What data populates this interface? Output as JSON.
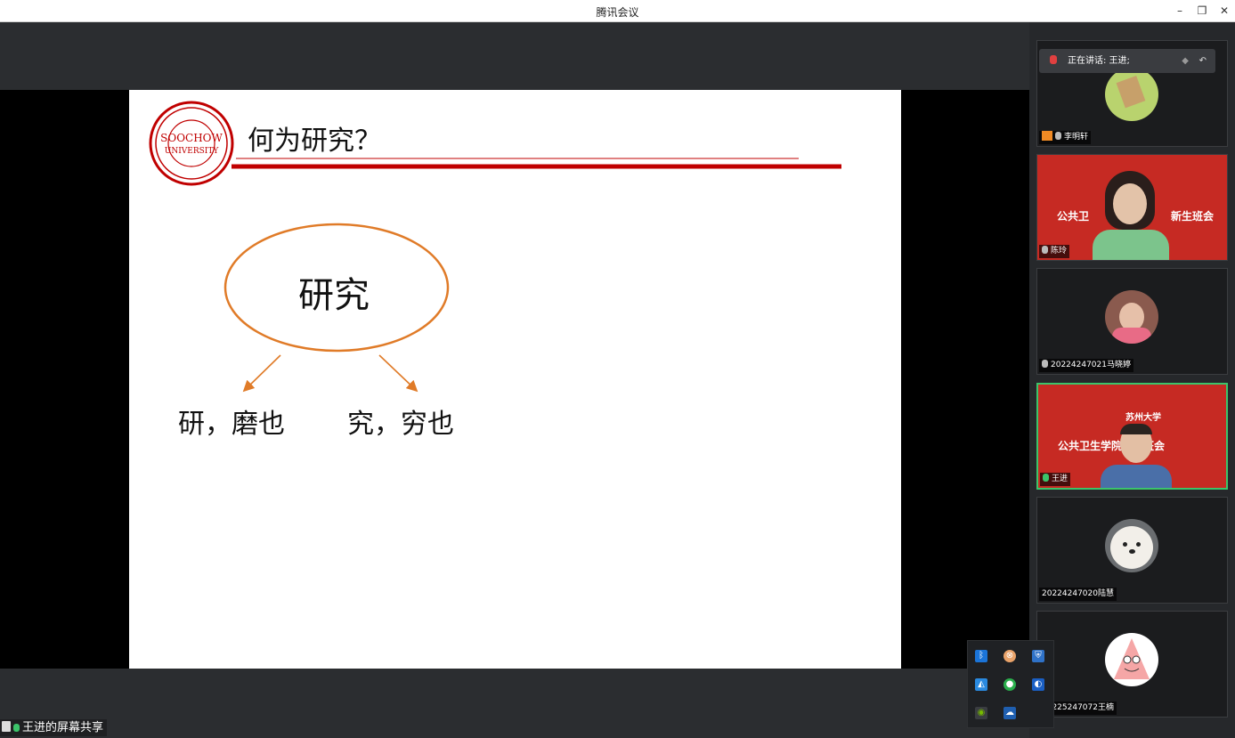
{
  "window": {
    "title": "腾讯会议"
  },
  "slide": {
    "title": "何为研究？",
    "center_word": "研究",
    "left_branch": "研，磨也",
    "right_branch": "究，穷也",
    "accent_color": "#c00000",
    "ellipse_color": "#e07b28"
  },
  "share_label": "王进的屏幕共享",
  "speaking": {
    "label": "正在讲话: 王进;"
  },
  "participants": [
    {
      "name": "李明轩",
      "video": false
    },
    {
      "name": "陈玲",
      "video": true
    },
    {
      "name": "20224247021马晓婷",
      "video": false
    },
    {
      "name": "王进",
      "video": true,
      "speaking": true
    },
    {
      "name": "20224247020陆慧",
      "video": false
    },
    {
      "name": "20225247072王楠",
      "video": false
    }
  ],
  "banner": {
    "text_left": "公共卫",
    "text_right": "新生班会",
    "text_full": "公共卫生学院新生班会",
    "brand": "苏州大学"
  }
}
